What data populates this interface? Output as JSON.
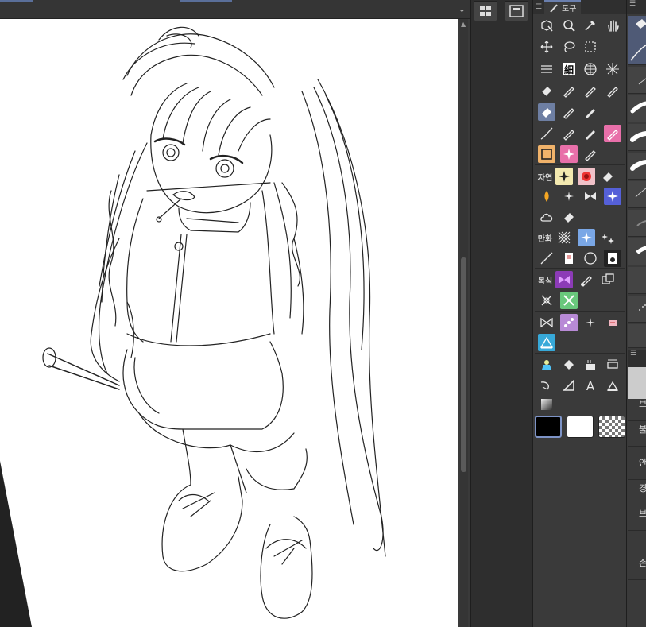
{
  "tool_panel": {
    "menu_icon": "hamburger-icon",
    "tab_icon": "brush-icon",
    "tab_label": "도구"
  },
  "tool_groups": [
    {
      "label": "",
      "tools": [
        "object-select-icon",
        "zoom-icon",
        "eyedropper-icon",
        "hand-icon"
      ]
    },
    {
      "label": "",
      "tools": [
        "move-icon",
        "lasso-icon",
        "rect-select-icon"
      ]
    },
    {
      "label": "",
      "tools": [
        "lines-icon",
        "fine-detail-icon",
        "grid-icon",
        "sparkle-icon"
      ]
    },
    {
      "label": "",
      "tools": [
        "eraser-icon",
        "pen-icon",
        "pencil-icon",
        "marker-icon"
      ]
    },
    {
      "label": "",
      "tools": [
        "eraser-active-icon",
        "pen2-icon",
        "pencil2-icon"
      ]
    },
    {
      "label": "",
      "tools": [
        "curve-icon",
        "pen3-icon",
        "pen4-icon",
        "pink-pen-icon"
      ]
    },
    {
      "label": "",
      "tools": [
        "orange-frame-icon",
        "pink-sparkle-icon",
        "pen5-icon"
      ]
    },
    {
      "label": "자연",
      "tools": [
        "yellow-sparkle-icon",
        "rose-icon",
        "eraser2-icon"
      ]
    },
    {
      "label": "",
      "tools": [
        "flame-icon",
        "twinkle-icon",
        "ribbon-icon",
        "blue-star-icon"
      ]
    },
    {
      "label": "",
      "tools": [
        "cloud-icon",
        "eraser3-icon"
      ]
    },
    {
      "label": "만화",
      "tools": [
        "crosshatch-icon",
        "blue-sparkle-icon",
        "stars-icon"
      ]
    },
    {
      "label": "",
      "tools": [
        "slash-icon",
        "scroll-icon",
        "circle-icon",
        "speaker-icon"
      ]
    },
    {
      "label": "복식",
      "tools": [
        "purple-ribbon-icon",
        "drop-pen-icon",
        "layers-icon"
      ]
    },
    {
      "label": "",
      "tools": [
        "x-pattern-icon",
        "green-pattern-icon"
      ]
    },
    {
      "label": "",
      "tools": [
        "bow-icon",
        "lace-icon",
        "small-sparkle-icon",
        "tag-icon"
      ]
    },
    {
      "label": "",
      "tools": [
        "blue-tent-icon"
      ]
    },
    {
      "label": "",
      "tools": [
        "cake-icon",
        "fill-bucket-icon",
        "text-cursor-icon",
        "ruler-icon"
      ]
    },
    {
      "label": "",
      "tools": [
        "swoosh-icon",
        "triangle-ruler-icon",
        "text-tool-icon",
        "balloon-icon"
      ]
    },
    {
      "label": "",
      "tools": [
        "gradient-icon"
      ]
    }
  ],
  "colors": {
    "main": "#000000",
    "sub": "#ffffff",
    "transparent": "transparent-color"
  },
  "subtool_props": [
    "브",
    "불",
    "안",
    "경",
    "브",
    "손"
  ],
  "accent": "#6e7fa3"
}
